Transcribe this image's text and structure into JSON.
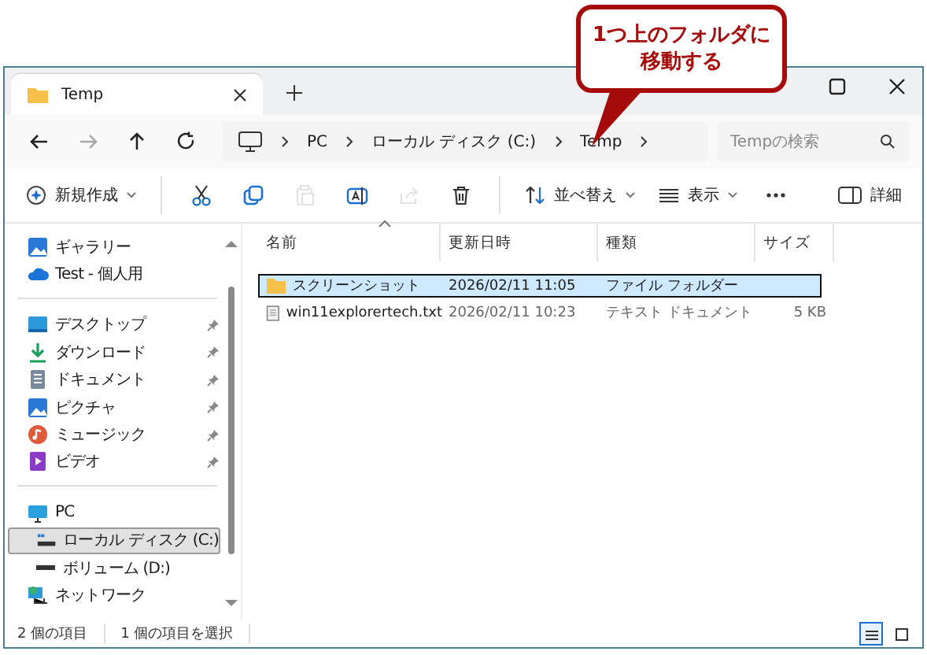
{
  "callout": {
    "lines": [
      "1つ上のフォルダに",
      "移動する"
    ]
  },
  "tabs": [
    {
      "label": "Temp",
      "selected": true
    }
  ],
  "nav": [
    {
      "kind": "back",
      "disabled": false
    },
    {
      "kind": "forward",
      "disabled": true
    },
    {
      "kind": "up",
      "disabled": false
    },
    {
      "kind": "refresh",
      "disabled": false
    }
  ],
  "breadcrumb": [
    "PC",
    "ローカル ディスク (C:)",
    "Temp"
  ],
  "search": {
    "placeholder": "Tempの検索"
  },
  "commands": [
    {
      "kind": "new",
      "label": "新規作成",
      "disabled": false
    },
    {
      "kind": "cut",
      "disabled": false
    },
    {
      "kind": "copy",
      "disabled": false
    },
    {
      "kind": "paste",
      "disabled": true
    },
    {
      "kind": "rename",
      "disabled": false
    },
    {
      "kind": "share",
      "disabled": true
    },
    {
      "kind": "delete",
      "disabled": false
    },
    {
      "kind": "sort",
      "label": "並べ替え",
      "disabled": false
    },
    {
      "kind": "view",
      "label": "表示",
      "disabled": false
    },
    {
      "kind": "more",
      "disabled": false
    }
  ],
  "details_button": {
    "label": "詳細"
  },
  "sidebar": {
    "sections": [
      [
        {
          "kind": "gallery",
          "label": "ギャラリー",
          "pinned": false,
          "selected": false
        },
        {
          "kind": "cloud",
          "label": "Test - 個人用",
          "pinned": false,
          "selected": false
        }
      ],
      [
        {
          "kind": "desktop",
          "label": "デスクトップ",
          "pinned": true,
          "selected": false
        },
        {
          "kind": "download",
          "label": "ダウンロード",
          "pinned": true,
          "selected": false
        },
        {
          "kind": "documents",
          "label": "ドキュメント",
          "pinned": true,
          "selected": false
        },
        {
          "kind": "pictures",
          "label": "ピクチャ",
          "pinned": true,
          "selected": false
        },
        {
          "kind": "music",
          "label": "ミュージック",
          "pinned": true,
          "selected": false
        },
        {
          "kind": "video",
          "label": "ビデオ",
          "pinned": true,
          "selected": false
        }
      ],
      [
        {
          "kind": "pc",
          "label": "PC",
          "pinned": false,
          "selected": false,
          "children": [
            {
              "kind": "drive",
              "label": "ローカル ディスク (C:)",
              "pinned": false,
              "selected": true
            },
            {
              "kind": "volume",
              "label": "ボリューム (D:)",
              "pinned": false,
              "selected": false
            }
          ]
        },
        {
          "kind": "network",
          "label": "ネットワーク",
          "pinned": false,
          "selected": false
        }
      ]
    ]
  },
  "columns": [
    {
      "label": "名前",
      "sorted": true
    },
    {
      "label": "更新日時",
      "sorted": false
    },
    {
      "label": "種類",
      "sorted": false
    },
    {
      "label": "サイズ",
      "sorted": false
    }
  ],
  "rows": [
    {
      "kind": "folder",
      "name": "スクリーンショット",
      "date": "2026/02/11 11:05",
      "type": "ファイル フォルダー",
      "selected": true
    },
    {
      "kind": "text",
      "name": "win11explorertech.txt",
      "date": "2026/02/11 10:23",
      "type": "テキスト ドキュメント",
      "size": "5 KB",
      "selected": false
    }
  ],
  "status": [
    "2 個の項目",
    "1 個の項目を選択"
  ],
  "view_modes": [
    {
      "kind": "details",
      "selected": true
    },
    {
      "kind": "tiles",
      "selected": false
    }
  ]
}
